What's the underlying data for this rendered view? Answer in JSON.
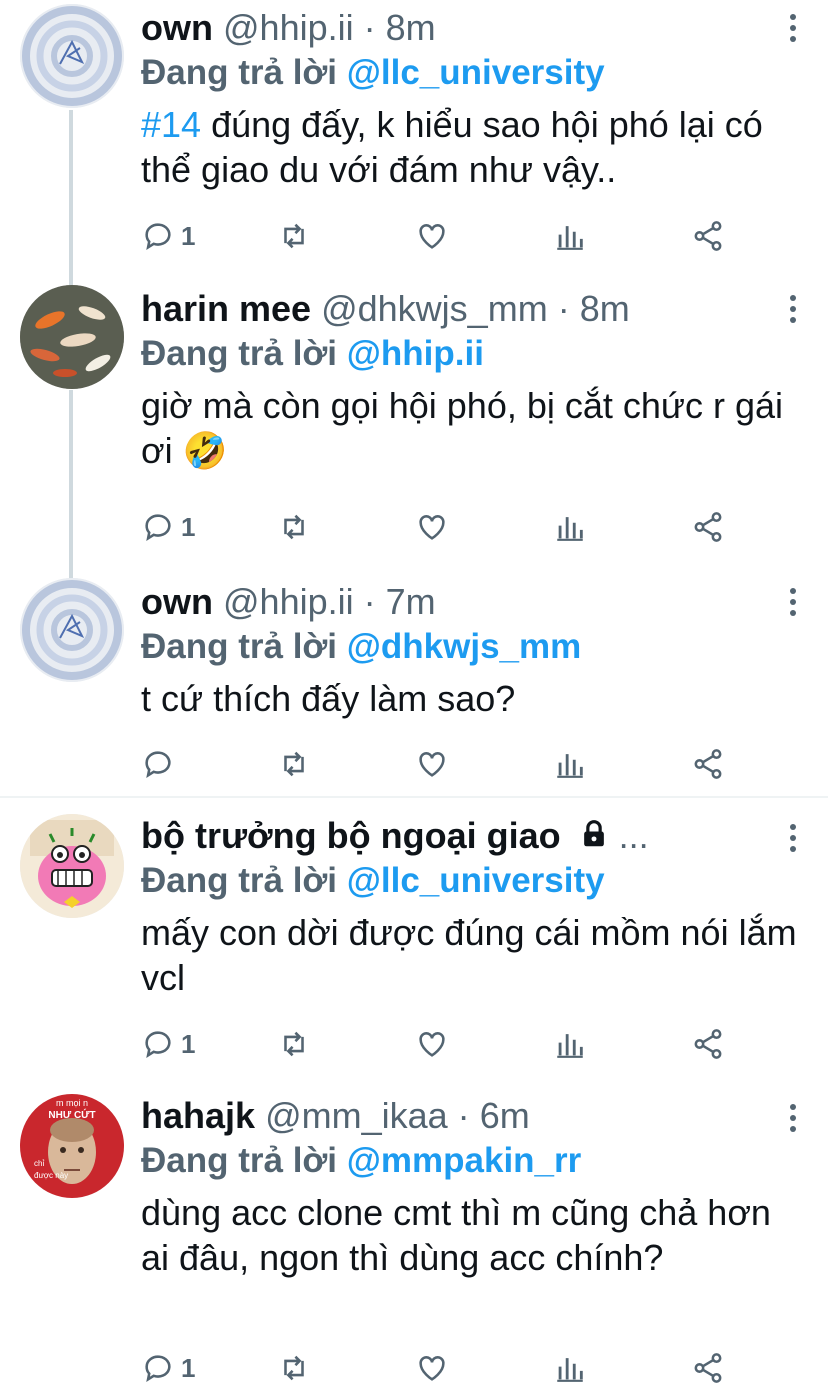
{
  "reply_prefix": "Đang trả lời",
  "tweets": [
    {
      "name": "own",
      "handle": "@hhip.ii",
      "sep": "·",
      "time": "8m",
      "reply_to": "@llc_university",
      "hashtag": "#14",
      "text": " đúng đấy, k hiểu sao hội phó lại có thể giao du với đám như vậy..",
      "reply_count": "1",
      "avatar_icon": "spiral-sticker-avatar"
    },
    {
      "name": "harin mee",
      "handle": "@dhkwjs_mm",
      "sep": "·",
      "time": "8m",
      "reply_to": "@hhip.ii",
      "text": "giờ mà còn gọi hội phó, bị cắt chức r gái ơi 🤣",
      "reply_count": "1",
      "avatar_icon": "koi-fish-avatar"
    },
    {
      "name": "own",
      "handle": "@hhip.ii",
      "sep": "·",
      "time": "7m",
      "reply_to": "@dhkwjs_mm",
      "text": "t cứ thích đấy làm sao?",
      "reply_count": "",
      "avatar_icon": "spiral-sticker-avatar"
    },
    {
      "name": "bộ trưởng bộ ngoại giao",
      "extra": "...",
      "reply_to": "@llc_university",
      "text": "mấy con dời được đúng cái mồm nói lắm vcl",
      "reply_count": "1",
      "avatar_icon": "pink-cartoon-avatar"
    },
    {
      "name": "hahajk",
      "handle": "@mm_ikaa",
      "sep": "·",
      "time": "6m",
      "reply_to": "@mmpakin_rr",
      "text": "dùng acc clone cmt thì m cũng chả hơn ai đâu, ngon thì dùng acc chính?",
      "reply_count": "1",
      "avatar_icon": "meme-face-avatar",
      "avatar_text_top": "m mọi n",
      "avatar_text_mid": "NHƯ CỨT",
      "avatar_text_low": "chỉ",
      "avatar_text_bottom": "được này"
    }
  ],
  "colors": {
    "accent": "#1d9bf0",
    "muted": "#536471",
    "thread": "#cfd9de"
  }
}
